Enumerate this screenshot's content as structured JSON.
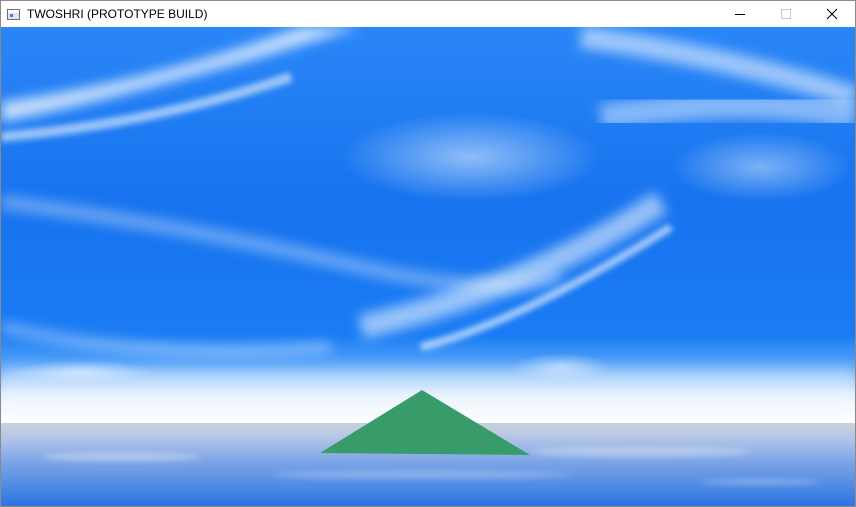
{
  "window": {
    "title": "TWOSHRI (PROTOTYPE BUILD)",
    "icon": "window-app-icon",
    "buttons": {
      "minimize": "minimize-icon",
      "maximize": "maximize-icon",
      "close": "close-icon"
    }
  },
  "scene": {
    "sky_color": "#1673ee",
    "cloud_color": "#ffffff",
    "horizon_color": "#ffffff",
    "water_color": "#2f78e0",
    "pyramid_color": "#379b6a"
  }
}
